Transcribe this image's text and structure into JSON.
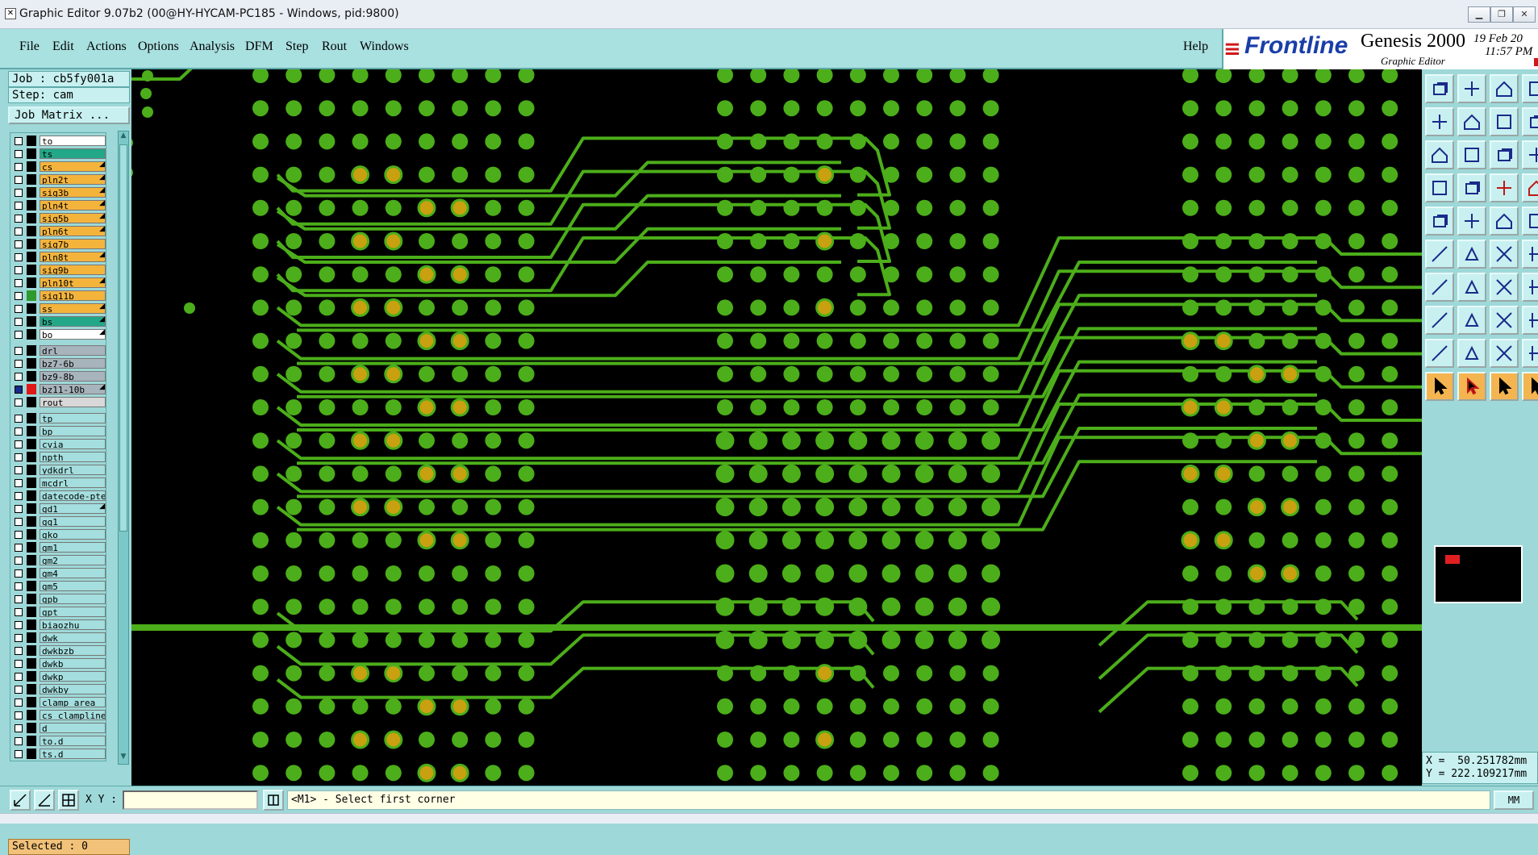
{
  "window": {
    "title": "Graphic Editor 9.07b2 (00@HY-HYCAM-PC185 - Windows, pid:9800)",
    "controls": [
      "minimize",
      "restore",
      "close"
    ]
  },
  "menubar": {
    "items": [
      {
        "label": "File",
        "name": "file"
      },
      {
        "label": "Edit",
        "name": "edit"
      },
      {
        "label": "Actions",
        "name": "actions"
      },
      {
        "label": "Options",
        "name": "options"
      },
      {
        "label": "Analysis",
        "name": "analysis"
      },
      {
        "label": "DFM",
        "name": "dfm"
      },
      {
        "label": "Step",
        "name": "step"
      },
      {
        "label": "Rout",
        "name": "rout"
      },
      {
        "label": "Windows",
        "name": "windows"
      }
    ],
    "help": "Help"
  },
  "logo": {
    "brand": "Frontline",
    "product": "Genesis 2000",
    "subtitle": "Graphic Editor",
    "date_line1": "19 Feb 20",
    "date_line2": "11:57 PM"
  },
  "job": {
    "job_label": "Job : cb5fy001a",
    "step_label": "Step: cam",
    "matrix_button": "Job Matrix ..."
  },
  "layers": {
    "group1": [
      {
        "name": "to",
        "color": "#ffffff",
        "swatch": "#000000",
        "arrow": false
      },
      {
        "name": "ts",
        "color": "#22a888",
        "swatch": "#000000",
        "arrow": false
      },
      {
        "name": "cs",
        "color": "#f4b43c",
        "swatch": "#000000",
        "arrow": true
      },
      {
        "name": "pln2t",
        "color": "#f4b43c",
        "swatch": "#000000",
        "arrow": true
      },
      {
        "name": "sig3b",
        "color": "#f4b43c",
        "swatch": "#000000",
        "arrow": true
      },
      {
        "name": "pln4t",
        "color": "#f4b43c",
        "swatch": "#000000",
        "arrow": true
      },
      {
        "name": "sig5b",
        "color": "#f4b43c",
        "swatch": "#000000",
        "arrow": true
      },
      {
        "name": "pln6t",
        "color": "#f4b43c",
        "swatch": "#000000",
        "arrow": true
      },
      {
        "name": "sig7b",
        "color": "#f4b43c",
        "swatch": "#000000",
        "arrow": false
      },
      {
        "name": "pln8t",
        "color": "#f4b43c",
        "swatch": "#000000",
        "arrow": true
      },
      {
        "name": "sig9b",
        "color": "#f4b43c",
        "swatch": "#000000",
        "arrow": false
      },
      {
        "name": "pln10t",
        "color": "#f4b43c",
        "swatch": "#000000",
        "arrow": true
      },
      {
        "name": "sig11b",
        "color": "#f4b43c",
        "swatch": "#2e9a2e",
        "arrow": false
      },
      {
        "name": "ss",
        "color": "#f4b43c",
        "swatch": "#000000",
        "arrow": true
      },
      {
        "name": "bs",
        "color": "#22a888",
        "swatch": "#000000",
        "arrow": true
      },
      {
        "name": "bo",
        "color": "#ffffff",
        "swatch": "#000000",
        "arrow": true
      }
    ],
    "group2": [
      {
        "name": "drl",
        "color": "#a8b4bc",
        "swatch": "#000000",
        "arrow": false
      },
      {
        "name": "bz7-6b",
        "color": "#a8b4bc",
        "swatch": "#000000",
        "arrow": false
      },
      {
        "name": "bz9-8b",
        "color": "#a8b4bc",
        "swatch": "#000000",
        "arrow": false
      },
      {
        "name": "bz11-10b",
        "color": "#a8b4bc",
        "swatch": "#e01818",
        "arrow": true
      },
      {
        "name": "rout",
        "color": "#d8d8d8",
        "swatch": "#000000",
        "arrow": false
      }
    ],
    "group3": [
      {
        "name": "tp",
        "color": "#a4dede",
        "swatch": "#000000",
        "arrow": false
      },
      {
        "name": "bp",
        "color": "#a4dede",
        "swatch": "#000000",
        "arrow": false
      },
      {
        "name": "cvia",
        "color": "#a4dede",
        "swatch": "#000000",
        "arrow": false
      },
      {
        "name": "npth",
        "color": "#a4dede",
        "swatch": "#000000",
        "arrow": false
      },
      {
        "name": "ydkdrl",
        "color": "#a4dede",
        "swatch": "#000000",
        "arrow": false
      },
      {
        "name": "mcdrl",
        "color": "#a4dede",
        "swatch": "#000000",
        "arrow": false
      },
      {
        "name": "datecode-pte",
        "color": "#a4dede",
        "swatch": "#000000",
        "arrow": false
      },
      {
        "name": "gd1",
        "color": "#a4dede",
        "swatch": "#000000",
        "arrow": true
      },
      {
        "name": "gg1",
        "color": "#a4dede",
        "swatch": "#000000",
        "arrow": false
      },
      {
        "name": "gko",
        "color": "#a4dede",
        "swatch": "#000000",
        "arrow": false
      },
      {
        "name": "gm1",
        "color": "#a4dede",
        "swatch": "#000000",
        "arrow": false
      },
      {
        "name": "gm2",
        "color": "#a4dede",
        "swatch": "#000000",
        "arrow": false
      },
      {
        "name": "gm4",
        "color": "#a4dede",
        "swatch": "#000000",
        "arrow": false
      },
      {
        "name": "gm5",
        "color": "#a4dede",
        "swatch": "#000000",
        "arrow": false
      },
      {
        "name": "gpb",
        "color": "#a4dede",
        "swatch": "#000000",
        "arrow": false
      },
      {
        "name": "gpt",
        "color": "#a4dede",
        "swatch": "#000000",
        "arrow": false
      },
      {
        "name": "biaozhu",
        "color": "#a4dede",
        "swatch": "#000000",
        "arrow": false
      },
      {
        "name": "dwk",
        "color": "#a4dede",
        "swatch": "#000000",
        "arrow": false
      },
      {
        "name": "dwkbzb",
        "color": "#a4dede",
        "swatch": "#000000",
        "arrow": false
      },
      {
        "name": "dwkb",
        "color": "#a4dede",
        "swatch": "#000000",
        "arrow": false
      },
      {
        "name": "dwkp",
        "color": "#a4dede",
        "swatch": "#000000",
        "arrow": false
      },
      {
        "name": "dwkby",
        "color": "#a4dede",
        "swatch": "#000000",
        "arrow": false
      },
      {
        "name": "clamp_area",
        "color": "#a4dede",
        "swatch": "#000000",
        "arrow": false
      },
      {
        "name": "cs_clampline",
        "color": "#a4dede",
        "swatch": "#000000",
        "arrow": false
      },
      {
        "name": "d",
        "color": "#a4dede",
        "swatch": "#000000",
        "arrow": false
      },
      {
        "name": "to.d",
        "color": "#a4dede",
        "swatch": "#000000",
        "arrow": false
      },
      {
        "name": "ts.d",
        "color": "#a4dede",
        "swatch": "#000000",
        "arrow": false
      }
    ]
  },
  "selected": "Selected : 0",
  "toolbar_icons": [
    "zoom-home-icon",
    "zoom-back-icon",
    "home-icon",
    "zoom-window-icon",
    "pan-left-icon",
    "pan-right-icon",
    "zoom-out-icon",
    "zoom-in-icon",
    "fit-all-icon",
    "fit-profile-icon",
    "scale-1-2-icon",
    "measure-icon",
    "snap-icon",
    "grid-icon",
    "connectivity-icon",
    "layer-toggle-icon",
    "pad-add-icon",
    "line-add-icon",
    "dimension-icon",
    "surface-icon",
    "netlist-icon",
    "delete-node-icon",
    "move-node-icon",
    "slot-icon",
    "draw-line-icon",
    "angle-line-icon",
    "undo-icon",
    "flag-icon",
    "polygon-select-icon",
    "break-line-icon",
    "move-icon",
    "copy-icon",
    "triangle-edit-icon",
    "triangle-alt-icon",
    "triangle-shape-icon",
    "triangle-fill-icon",
    "select-pointer-icon",
    "select-pointer-red-icon",
    "select-pointer-alt-icon",
    "select-pointer-orange-icon"
  ],
  "coords": {
    "x": "X =  50.251782mm",
    "y": "Y = 222.109217mm"
  },
  "status": {
    "xy_label": "X Y :",
    "xy_value": "",
    "message": "<M1> - Select first corner",
    "unit": "MM"
  },
  "colors": {
    "pad": "#4cae1a",
    "via_ring": "#c8a010",
    "trace": "#4cae1a",
    "board": "#000000",
    "panel": "#9ed8d8"
  }
}
